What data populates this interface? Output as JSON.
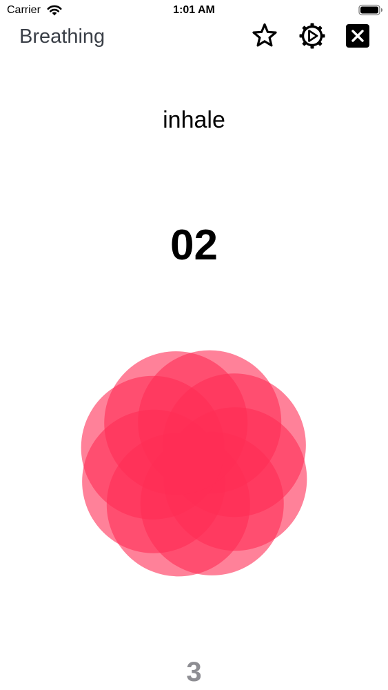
{
  "status_bar": {
    "carrier": "Carrier",
    "time": "1:01 AM",
    "wifi_icon": "wifi-icon",
    "battery_icon": "battery-icon"
  },
  "nav": {
    "title": "Breathing",
    "favorite_icon": "star-icon",
    "settings_icon": "gear-play-icon",
    "close_icon": "close-icon"
  },
  "session": {
    "phase": "inhale",
    "seconds_remaining": "02",
    "cycle_count": "3"
  },
  "colors": {
    "petal": "#ff2d55",
    "title_text": "#3a3f47",
    "cycle_text": "#8e8e93"
  }
}
